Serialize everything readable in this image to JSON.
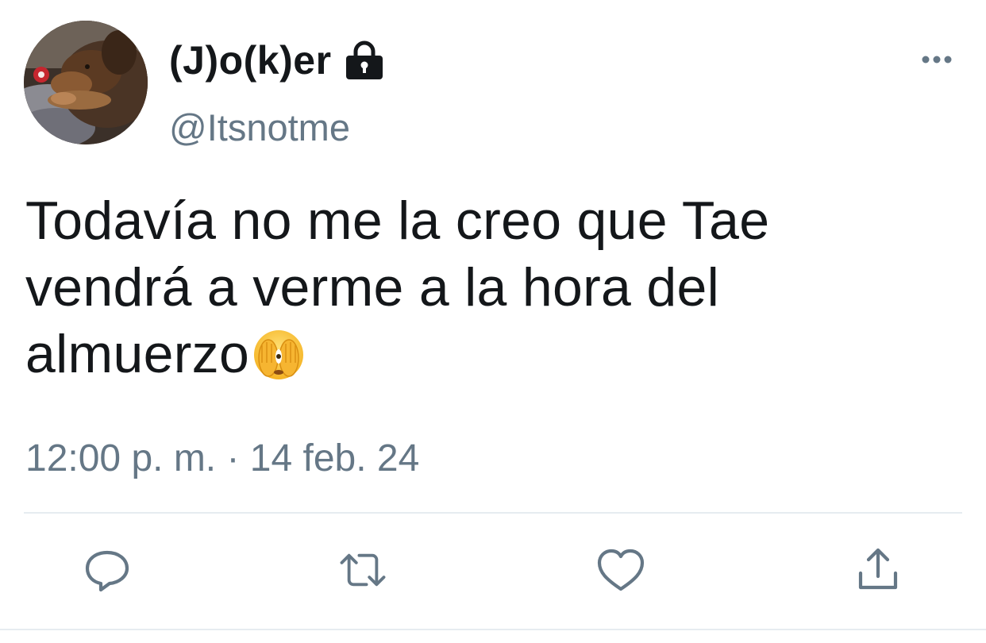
{
  "user": {
    "display_name": "(J)o(k)er",
    "handle": "@Itsnotme",
    "avatar_icon": "dog-photo-avatar",
    "protected_icon": "lock-icon"
  },
  "tweet": {
    "lines": [
      "Todavía no me la creo que Tae",
      "vendrá a verme a la hora del",
      "almuerzo"
    ],
    "emoji": "face-covering-eyes-emoji",
    "timestamp": "12:00 p. m. · 14 feb. 24"
  },
  "actions": {
    "reply_icon": "reply-icon",
    "retweet_icon": "retweet-icon",
    "like_icon": "heart-icon",
    "share_icon": "share-icon",
    "more_icon": "more-icon"
  },
  "colors": {
    "text": "#14171a",
    "secondary": "#657786",
    "divider": "#e6ecf0"
  }
}
